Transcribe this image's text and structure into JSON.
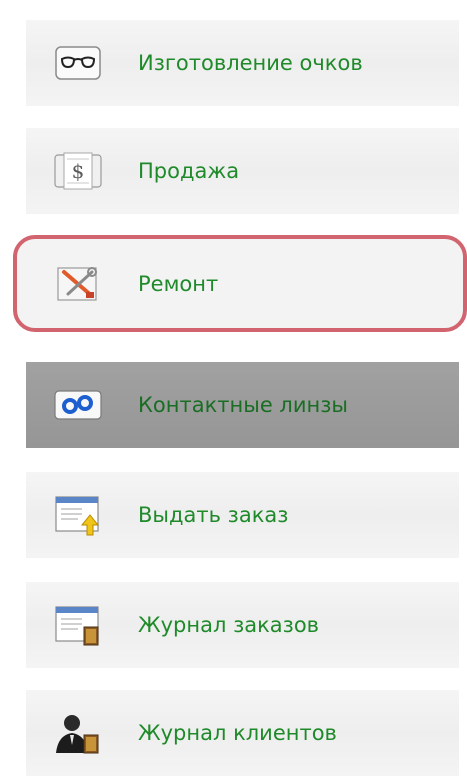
{
  "menu": {
    "items": [
      {
        "label": "Изготовление очков",
        "icon": "glasses-icon"
      },
      {
        "label": "Продажа",
        "icon": "dollar-document-icon"
      },
      {
        "label": "Ремонт",
        "icon": "repair-tools-icon"
      },
      {
        "label": "Контактные линзы",
        "icon": "contact-lenses-icon"
      },
      {
        "label": "Выдать заказ",
        "icon": "issue-order-icon"
      },
      {
        "label": "Журнал заказов",
        "icon": "orders-journal-icon"
      },
      {
        "label": "Журнал клиентов",
        "icon": "clients-journal-icon"
      }
    ],
    "highlighted_item": "Ремонт",
    "active_item": "Контактные линзы"
  },
  "colors": {
    "label_green": "#1f8a2a",
    "highlight_border": "#d26470",
    "active_background": "#9c9c9c",
    "item_background": "#f0f0f0"
  }
}
